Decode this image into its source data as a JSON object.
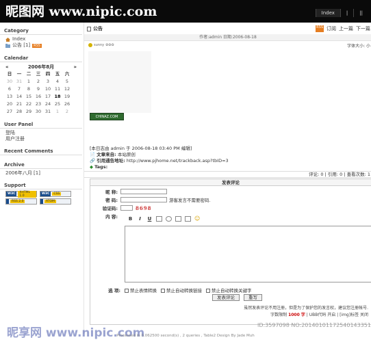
{
  "header": {
    "watermark_top": "昵图网 www.nipic.com",
    "nav": [
      "Index",
      "|",
      "||"
    ]
  },
  "sidebar": {
    "category_title": "Category",
    "category_items": [
      {
        "label": "Index",
        "badge": ""
      },
      {
        "label": "公告 [1]",
        "badge": "RSS"
      }
    ],
    "calendar_title": "Calendar",
    "calendar": {
      "prev": "«",
      "next": "»",
      "month": "2006年8月",
      "weekdays": [
        "日",
        "一",
        "二",
        "三",
        "四",
        "五",
        "六"
      ],
      "days": [
        "30",
        "31",
        "1",
        "2",
        "3",
        "4",
        "5",
        "6",
        "7",
        "8",
        "9",
        "10",
        "11",
        "12",
        "13",
        "14",
        "15",
        "16",
        "17",
        "18",
        "19",
        "20",
        "21",
        "22",
        "23",
        "24",
        "25",
        "26",
        "27",
        "28",
        "29",
        "30",
        "31",
        "1",
        "2"
      ]
    },
    "user_panel_title": "User Panel",
    "user_panel_items": [
      "登陆",
      "用户注册"
    ],
    "recent_comments_title": "Recent Comments",
    "archive_title": "Archive",
    "archive_items": [
      "2006年八月 [1]"
    ],
    "support_title": "Support",
    "support_badges": [
      {
        "left": "W3C",
        "right": "XHTML 1.0"
      },
      {
        "left": "W3C",
        "right": "CSS"
      },
      {
        "left": "",
        "right": "RSS 2.0"
      },
      {
        "left": "",
        "right": "ATOM"
      }
    ]
  },
  "post": {
    "title": "公告",
    "tools": {
      "rss": "RSS",
      "subscribe": "订阅",
      "prev": "上一篇",
      "next": "下一篇"
    },
    "meta": "作者:admin 日期:2006-08-18",
    "mood": "sunny",
    "font_size_label": "字体大小: 小",
    "logo_button": "CHINAZ.COM",
    "info_line1": "[本日志由 admin 于 2006-08-18 03:40 PM 编辑]",
    "source_label": "文章来自:",
    "source_value": "本站原创",
    "trackback_label": "引用通告地址:",
    "trackback_value": "http://www.pjhome.net/trackback.asp?tbID=3",
    "tags_label": "Tags:",
    "stats": "评论: 0 | 引用: 0 | 查看次数: 1"
  },
  "comment_form": {
    "title": "发表评论",
    "nickname_label": "昵    称:",
    "password_label": "密    码:",
    "password_hint": "游客发言不需要密码.",
    "verify_label": "验证码:",
    "verify_code": "8698",
    "content_label": "内    容:",
    "toolbar": [
      "B",
      "I",
      "U"
    ],
    "options_label": "选    项:",
    "options": [
      "禁止表情转换",
      "禁止自动转换链接",
      "禁止自动转换关键字"
    ],
    "submit_label": "发表评论",
    "reset_label": "重写",
    "note1": "虽然发表评论不用注册，但是为了保护您的发言权，建议您注册帐号.",
    "note2_prefix": "字数限制",
    "note2_limit": "1000 字",
    "note2_suffix": "| UBB代码 开启 | [img]标签 关闭"
  },
  "footer": "Processed in 0.062500 second(s) , 2 queries , Table2 Design By Jade Muh",
  "watermark_bottom": "昵享网 www.nipic.com",
  "watermark_id": "ID:3597098 NO:20140101172540143351"
}
